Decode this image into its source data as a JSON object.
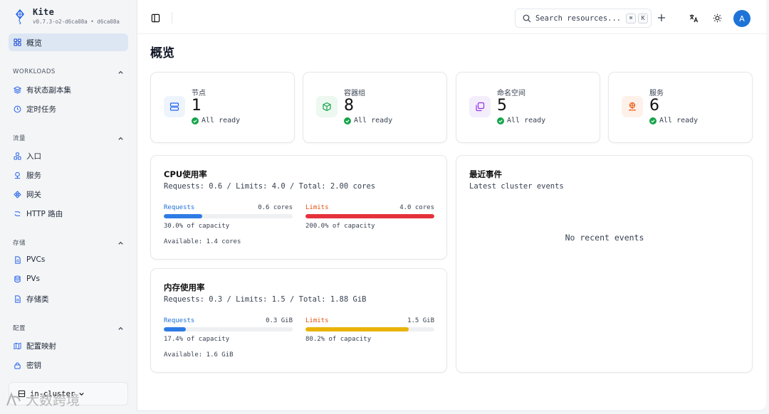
{
  "brand": {
    "name": "Kite",
    "version": "v0.7.3-o2-d6ca08a • d6ca08a"
  },
  "sidebar": {
    "active": {
      "label": "概览"
    },
    "groups": [
      {
        "label": "WORKLOADS",
        "items": [
          {
            "label": "有状态副本集",
            "icon": "layers-icon"
          },
          {
            "label": "定时任务",
            "icon": "clock-icon"
          }
        ]
      },
      {
        "label": "流量",
        "items": [
          {
            "label": "入口",
            "icon": "network-icon"
          },
          {
            "label": "服务",
            "icon": "service-icon"
          },
          {
            "label": "网关",
            "icon": "gateway-icon"
          },
          {
            "label": "HTTP 路由",
            "icon": "route-icon"
          }
        ]
      },
      {
        "label": "存储",
        "items": [
          {
            "label": "PVCs",
            "icon": "file-icon"
          },
          {
            "label": "PVs",
            "icon": "database-icon"
          },
          {
            "label": "存储类",
            "icon": "file-icon"
          }
        ]
      },
      {
        "label": "配置",
        "items": [
          {
            "label": "配置映射",
            "icon": "map-icon"
          },
          {
            "label": "密钥",
            "icon": "lock-icon"
          }
        ]
      }
    ],
    "cluster": "in-cluster",
    "watermark": "大数跨境"
  },
  "topbar": {
    "search_placeholder": "Search resources...",
    "kbd_cmd": "⌘",
    "kbd_k": "K",
    "avatar": "A"
  },
  "page": {
    "title": "概览"
  },
  "stats": [
    {
      "label": "节点",
      "value": "1",
      "status": "All ready",
      "icon": "server-icon",
      "color": "#2563eb",
      "bg": "#eef4fc"
    },
    {
      "label": "容器组",
      "value": "8",
      "status": "All ready",
      "icon": "cube-icon",
      "color": "#16a34a",
      "bg": "#edf8f0"
    },
    {
      "label": "命名空间",
      "value": "5",
      "status": "All ready",
      "icon": "copy-icon",
      "color": "#9333ea",
      "bg": "#f4eefc"
    },
    {
      "label": "服务",
      "value": "6",
      "status": "All ready",
      "icon": "network-icon",
      "color": "#ea580c",
      "bg": "#fdf1ea"
    }
  ],
  "cpu": {
    "title": "CPU使用率",
    "summary": "Requests: 0.6 / Limits: 4.0 / Total: 2.00 cores",
    "requests": {
      "label": "Requests",
      "value": "0.6 cores",
      "note": "30.0% of capacity",
      "percent": 30.0
    },
    "limits": {
      "label": "Limits",
      "value": "4.0 cores",
      "note": "200.0% of capacity",
      "percent": 200.0
    },
    "available": "Available: 1.4 cores"
  },
  "memory": {
    "title": "内存使用率",
    "summary": "Requests: 0.3 / Limits: 1.5 / Total: 1.88 GiB",
    "requests": {
      "label": "Requests",
      "value": "0.3 GiB",
      "note": "17.4% of capacity",
      "percent": 17.4
    },
    "limits": {
      "label": "Limits",
      "value": "1.5 GiB",
      "note": "80.2% of capacity",
      "percent": 80.2
    },
    "available": "Available: 1.6 GiB"
  },
  "events": {
    "title": "最近事件",
    "subtitle": "Latest cluster events",
    "empty": "No recent events"
  },
  "colors": {
    "requests": "#2f7be5",
    "limits_cpu": "#e5323b",
    "limits_mem": "#eab308",
    "requests_label": "#1d6fd8",
    "limits_label": "#e0530f",
    "ready": "#16a34a"
  }
}
